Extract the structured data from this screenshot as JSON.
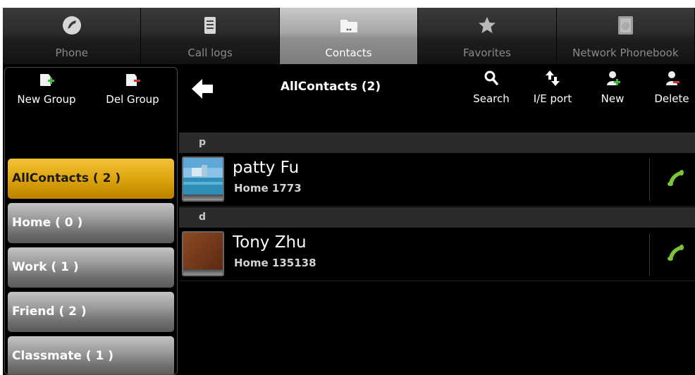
{
  "tabs": [
    {
      "label": "Phone",
      "icon": "phone-icon",
      "active": false
    },
    {
      "label": "Call logs",
      "icon": "call-log-icon",
      "active": false
    },
    {
      "label": "Contacts",
      "icon": "contacts-folder-icon",
      "active": true
    },
    {
      "label": "Favorites",
      "icon": "star-icon",
      "active": false
    },
    {
      "label": "Network Phonebook",
      "icon": "network-phonebook-icon",
      "active": false
    }
  ],
  "sidebar": {
    "new_group": {
      "label": "New Group",
      "icon": "new-group-icon"
    },
    "del_group": {
      "label": "Del Group",
      "icon": "delete-group-icon"
    },
    "groups": [
      {
        "label": "AllContacts ( 2 )",
        "selected": true
      },
      {
        "label": "Home ( 0 )",
        "selected": false
      },
      {
        "label": "Work ( 1 )",
        "selected": false
      },
      {
        "label": "Friend ( 2 )",
        "selected": false
      },
      {
        "label": "Classmate ( 1 )",
        "selected": false
      }
    ]
  },
  "toolbar": {
    "back_icon": "back-arrow-icon",
    "title": "AllContacts (2)",
    "buttons": [
      {
        "label": "Search",
        "icon": "search-icon"
      },
      {
        "label": "I/E port",
        "icon": "import-export-icon"
      },
      {
        "label": "New",
        "icon": "new-contact-icon"
      },
      {
        "label": "Delete",
        "icon": "delete-contact-icon"
      }
    ]
  },
  "contacts": {
    "sections": [
      {
        "letter": "p",
        "entries": [
          {
            "name": "patty Fu",
            "phone": "Home 1773",
            "avatar": "photo-landscape"
          }
        ]
      },
      {
        "letter": "d",
        "entries": [
          {
            "name": "Tony Zhu",
            "phone": "Home 135138",
            "avatar": "photo-brown"
          }
        ]
      }
    ]
  },
  "colors": {
    "active_tab": "#a5a5a5",
    "selected_group": "#e1a812",
    "call_green": "#7cc43a",
    "section_header": "#2b2b2b"
  }
}
